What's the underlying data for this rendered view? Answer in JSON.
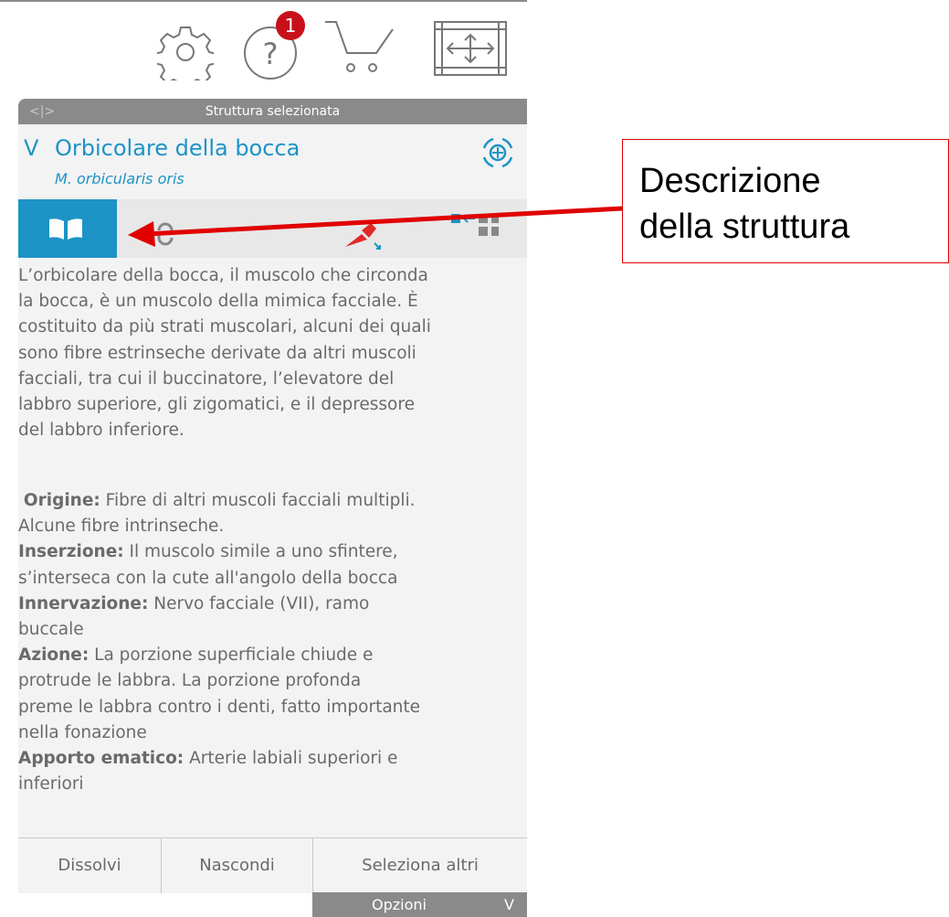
{
  "toolbar": {
    "help_badge": "1",
    "icons": [
      "gear-icon",
      "help-icon",
      "cart-icon",
      "fullscreen-icon"
    ]
  },
  "panel": {
    "header_title": "Struttura selezionata",
    "header_nav": "<|>",
    "structure_name": "Orbicolare della bocca",
    "structure_latin": "M. orbicularis oris",
    "chevron": "V",
    "tabs": [
      "book-icon",
      "link-icon",
      "pin-icon",
      "layout-icon"
    ],
    "description": [
      "L’orbicolare della bocca, il muscolo che circonda",
      "la bocca, è un muscolo della mimica facciale. È",
      "costituito da più strati muscolari, alcuni dei quali",
      "sono fibre estrinseche derivate da altri muscoli",
      "facciali, tra cui il buccinatore, l’elevatore del",
      "labbro superiore, gli zigomatici, e il depressore",
      "del labbro inferiore."
    ],
    "fields": {
      "origin_label": "Origine:",
      "origin_text": " Fibre di altri muscoli facciali multipli.",
      "origin_text2": "Alcune fibre intrinseche.",
      "insertion_label": "Inserzione:",
      "insertion_text": " Il muscolo simile a uno sfintere,",
      "insertion_text2": "s’interseca con la cute all'angolo della bocca",
      "innervation_label": "Innervazione:",
      "innervation_text": " Nervo facciale (VII), ramo",
      "innervation_text2": "buccale",
      "action_label": "Azione:",
      "action_text": " La porzione superficiale chiude e",
      "action_text2": "protrude le labbra. La porzione profonda",
      "action_text3": "preme le labbra contro i denti, fatto importante",
      "action_text4": "nella fonazione",
      "blood_label": "Apporto ematico:",
      "blood_text": " Arterie labiali superiori e",
      "blood_text2": "inferiori"
    },
    "buttons": {
      "dissolve": "Dissolvi",
      "hide": "Nascondi",
      "select_others": "Seleziona altri"
    },
    "options_label": "Opzioni",
    "options_chevron": "V"
  },
  "callout": {
    "line1": "Descrizione",
    "line2": "della struttura",
    "border_color": "#e00000"
  },
  "colors": {
    "accent": "#1d93c6",
    "header": "#8a8a8a",
    "badge": "#c8101a",
    "arrow": "#e00000"
  }
}
